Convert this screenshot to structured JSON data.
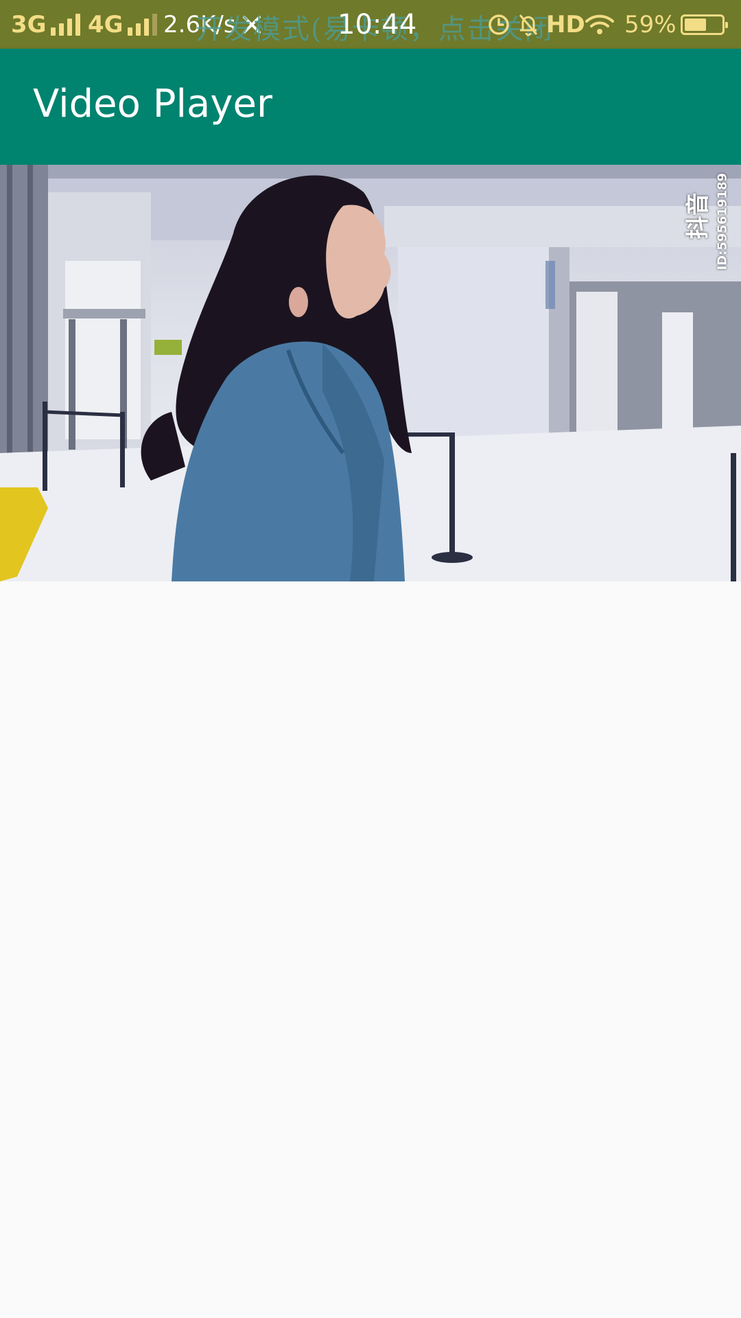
{
  "status_bar": {
    "network1": "3G",
    "network2": "4G",
    "speed": "2.6K/s",
    "dev_mode_text": "开发模式(易卡顿，点击关闭",
    "time": "10:44",
    "hd": "HD",
    "battery_percent": "59%",
    "battery_level": 0.59,
    "icons": [
      "signal-icon",
      "transfer-off-icon",
      "alarm-icon",
      "notifications-off-icon",
      "wifi-icon",
      "battery-icon"
    ]
  },
  "app_bar": {
    "title": "Video Player",
    "color": "#00836f"
  },
  "video": {
    "watermark_id": "ID:595619189",
    "watermark_logo": "抖音"
  },
  "colors": {
    "status_bar": "#6f7a2a",
    "status_text": "#f3dd86",
    "background": "#fafafa"
  }
}
